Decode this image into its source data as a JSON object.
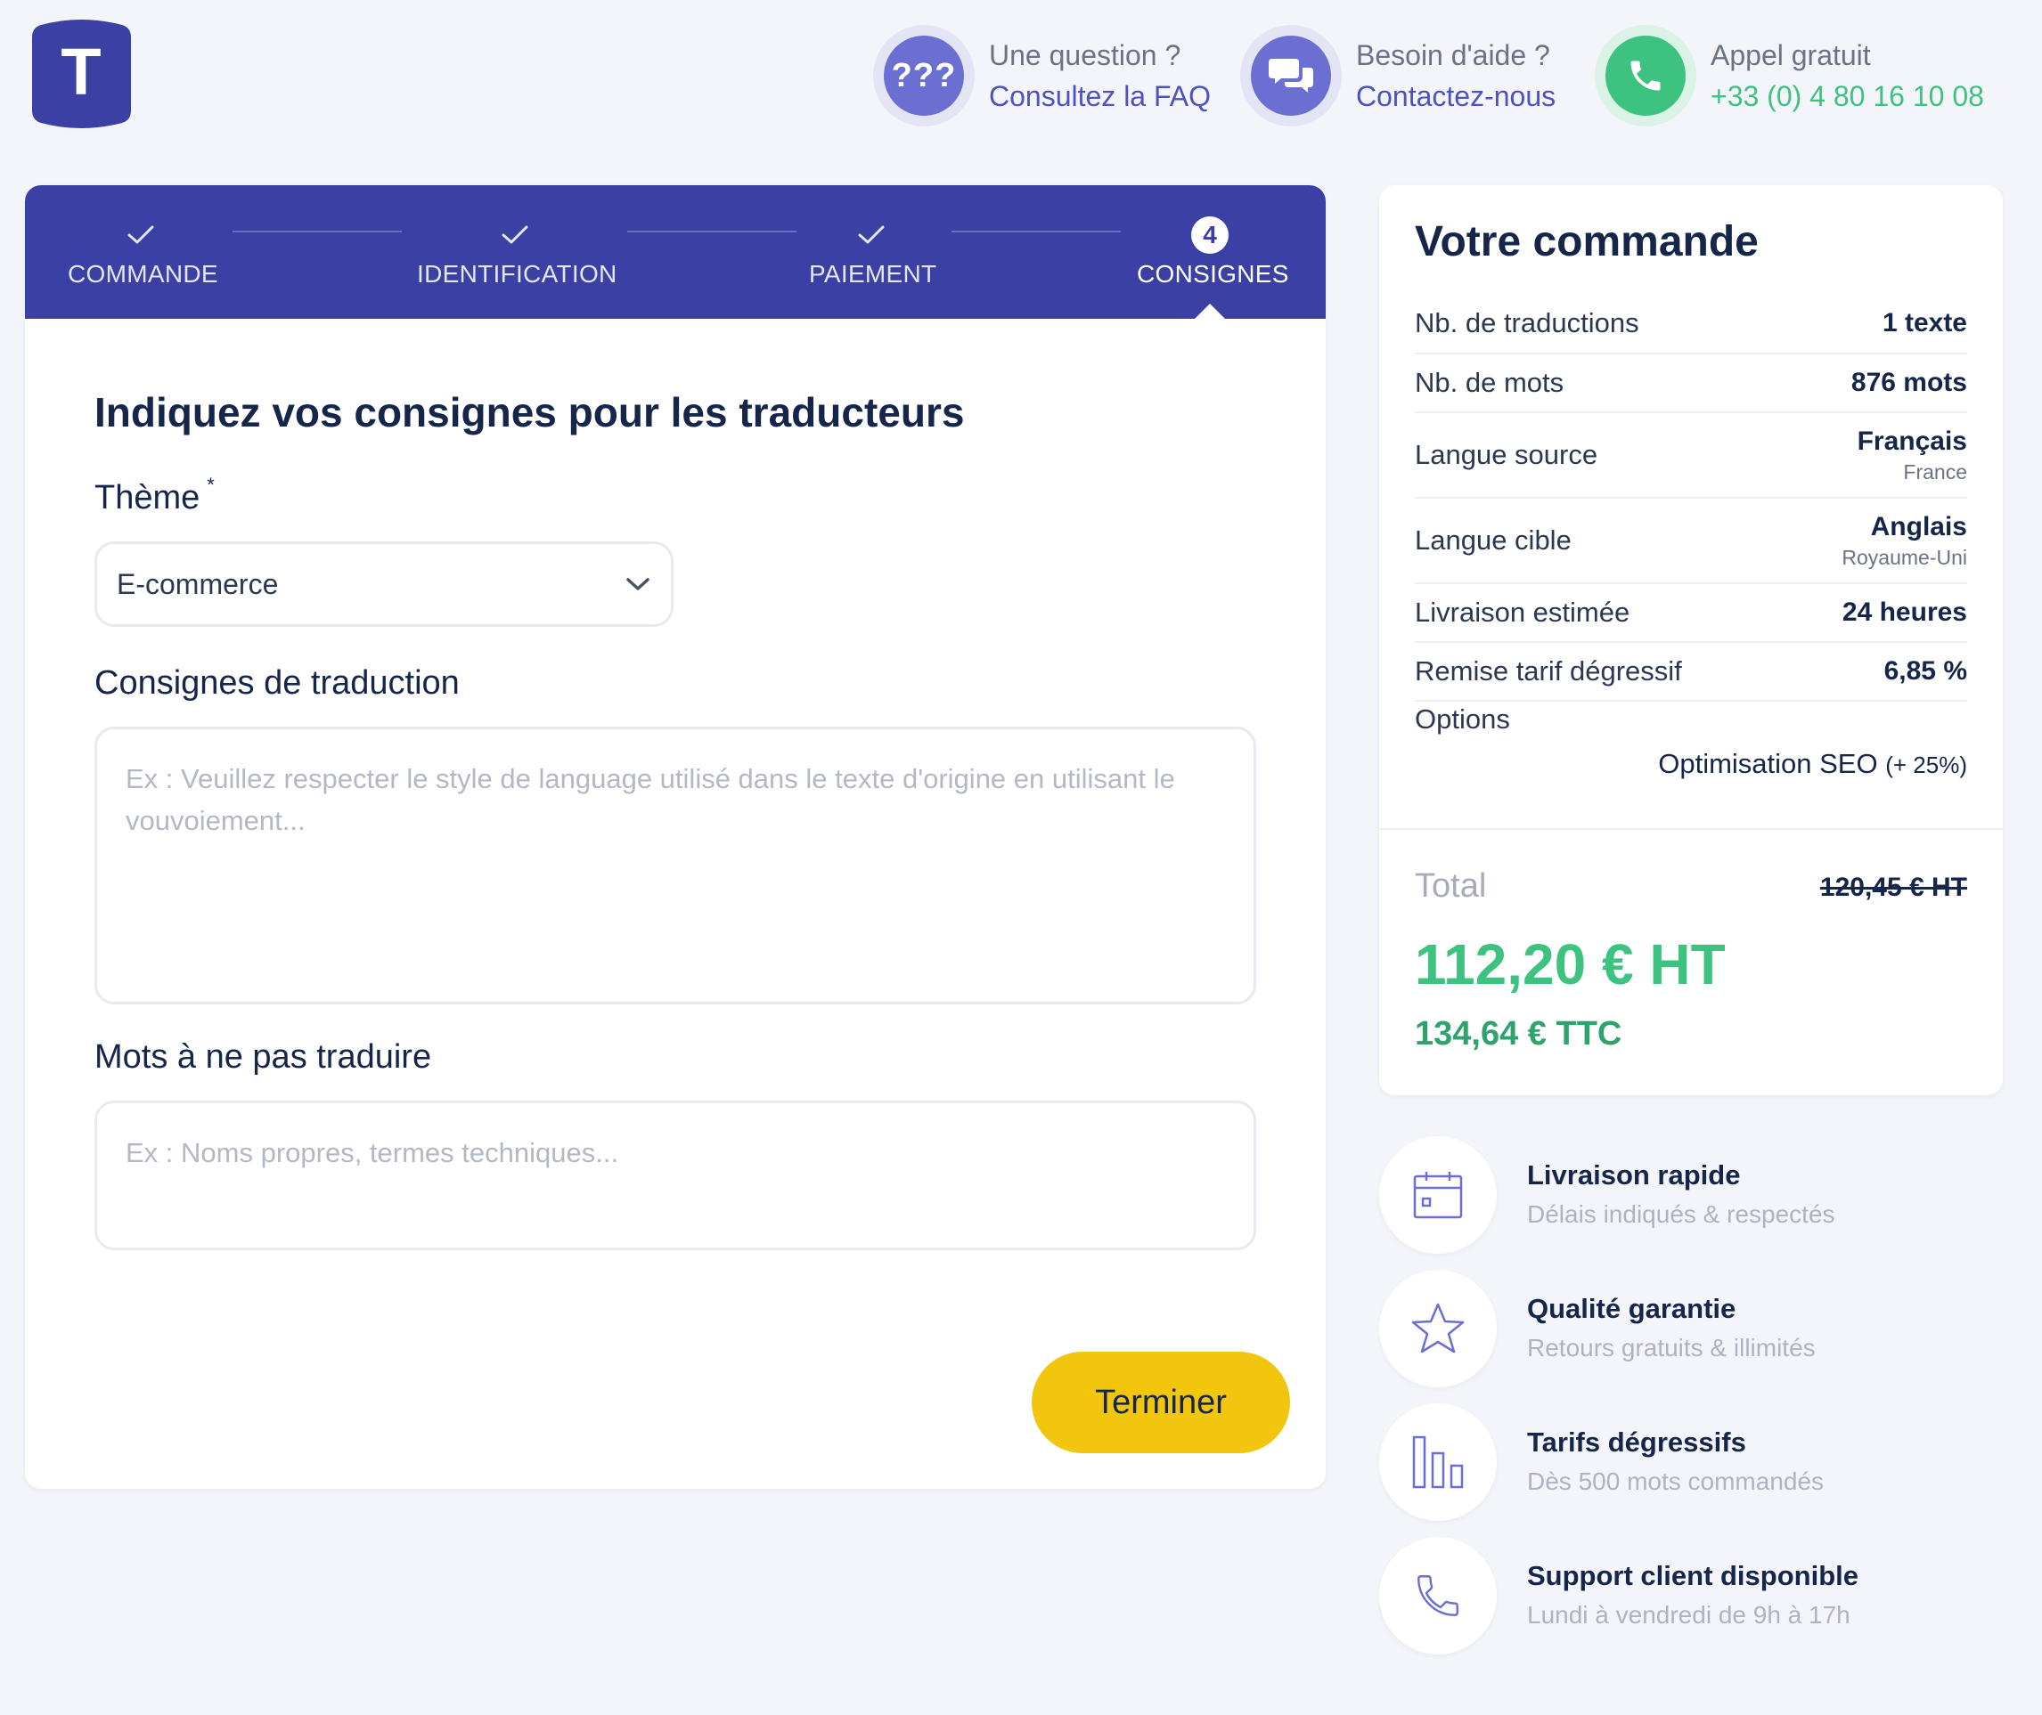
{
  "header": {
    "logo_letter": "T",
    "contacts": [
      {
        "icon": "question-marks-icon",
        "badge": "???",
        "line1": "Une question ?",
        "line2": "Consultez la FAQ"
      },
      {
        "icon": "chat-bubbles-icon",
        "line1": "Besoin d'aide ?",
        "line2": "Contactez-nous"
      },
      {
        "icon": "phone-icon",
        "line1": "Appel gratuit",
        "line2": "+33 (0) 4 80 16 10 08"
      }
    ]
  },
  "stepper": {
    "steps": [
      {
        "label": "COMMANDE",
        "done": true
      },
      {
        "label": "IDENTIFICATION",
        "done": true
      },
      {
        "label": "PAIEMENT",
        "done": true
      },
      {
        "label": "CONSIGNES",
        "number": "4",
        "active": true
      }
    ]
  },
  "form": {
    "title": "Indiquez vos consignes pour les traducteurs",
    "theme_label": "Thème",
    "theme_required": "*",
    "theme_value": "E-commerce",
    "instructions_label": "Consignes de traduction",
    "instructions_placeholder": "Ex : Veuillez respecter le style de language utilisé dans le texte d'origine en utilisant le vouvoiement...",
    "donottranslate_label": "Mots à ne pas traduire",
    "donottranslate_placeholder": "Ex : Noms propres, termes techniques...",
    "finish_button": "Terminer"
  },
  "order": {
    "title": "Votre commande",
    "rows": [
      {
        "key": "Nb. de traductions",
        "value": "1 texte"
      },
      {
        "key": "Nb. de mots",
        "value": "876 mots"
      },
      {
        "key": "Langue source",
        "value": "Français",
        "sub": "France"
      },
      {
        "key": "Langue cible",
        "value": "Anglais",
        "sub": "Royaume-Uni"
      },
      {
        "key": "Livraison estimée",
        "value": "24 heures"
      },
      {
        "key": "Remise tarif dégressif",
        "value": "6,85 %"
      }
    ],
    "options_label": "Options",
    "options_value": "Optimisation SEO",
    "options_pct": "(+ 25%)",
    "total_label": "Total",
    "old_price": "120,45 € HT",
    "price_ht": "112,20 € HT",
    "price_ttc": "134,64 € TTC"
  },
  "features": [
    {
      "icon": "calendar-icon",
      "title": "Livraison rapide",
      "subtitle": "Délais indiqués & respectés"
    },
    {
      "icon": "star-icon",
      "title": "Qualité garantie",
      "subtitle": "Retours gratuits & illimités"
    },
    {
      "icon": "bar-chart-icon",
      "title": "Tarifs dégressifs",
      "subtitle": "Dès 500 mots commandés"
    },
    {
      "icon": "phone-outline-icon",
      "title": "Support client disponible",
      "subtitle": "Lundi à vendredi de 9h à 17h"
    }
  ],
  "colors": {
    "primary": "#3b40a4",
    "accent_purple": "#6b6fd1",
    "green": "#3ec27f",
    "yellow": "#f2c50f",
    "text_dark": "#16254a"
  }
}
